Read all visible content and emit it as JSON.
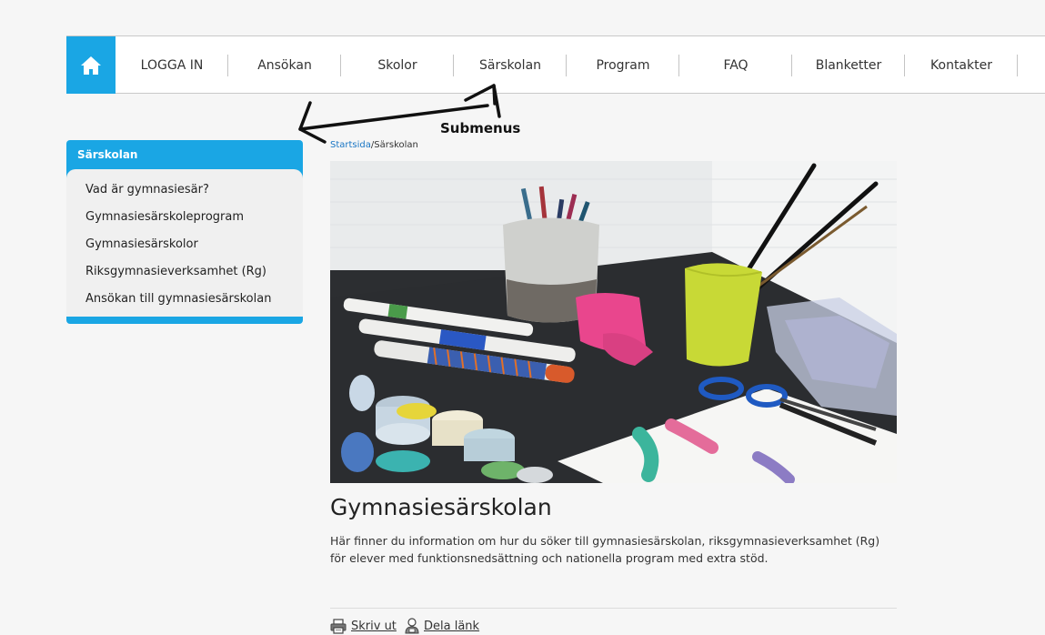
{
  "nav": {
    "home_icon": "home-icon",
    "items": [
      "LOGGA IN",
      "Ansökan",
      "Skolor",
      "Särskolan",
      "Program",
      "FAQ",
      "Blanketter",
      "Kontakter"
    ]
  },
  "annotation": {
    "label": "Submenus"
  },
  "sidebar": {
    "title": "Särskolan",
    "items": [
      "Vad är gymnasiesär?",
      "Gymnasiesärskoleprogram",
      "Gymnasiesärskolor",
      "Riksgymnasieverksamhet (Rg)",
      "Ansökan till gymnasiesärskolan"
    ]
  },
  "breadcrumb": {
    "home": "Startsida",
    "current": "/Särskolan"
  },
  "main": {
    "title": "Gymnasiesärskolan",
    "intro": "Här finner du information om hur du söker till gymnasiesärskolan,  riksgymnasieverksamhet (Rg) för elever med funktionsnedsättning och nationella program med extra stöd."
  },
  "actions": {
    "print": "Skriv ut",
    "share": "Dela länk"
  },
  "colors": {
    "accent": "#1aa6e4",
    "link": "#1a76c4",
    "background": "#f6f6f6"
  }
}
